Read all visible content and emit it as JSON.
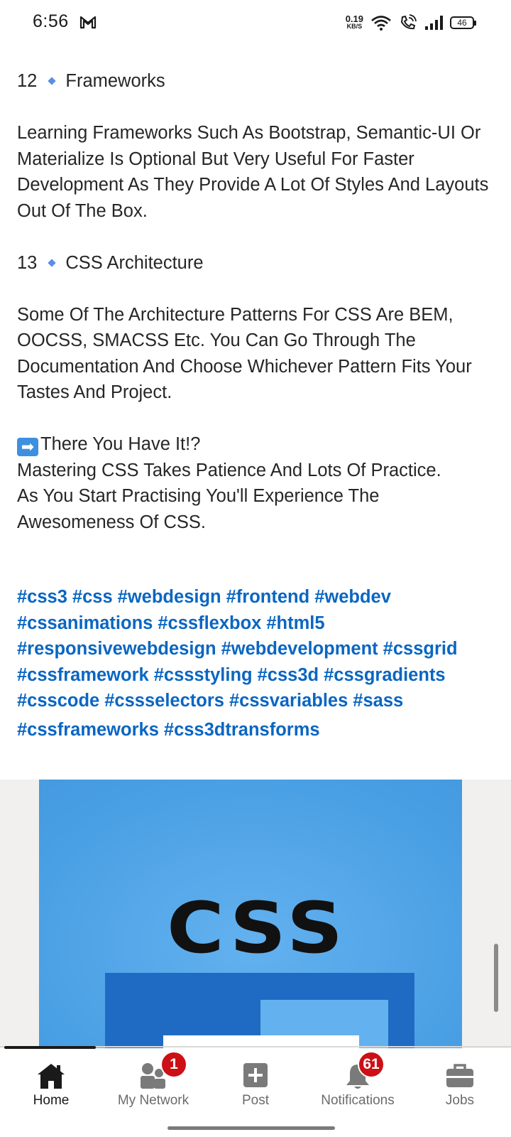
{
  "status_bar": {
    "time": "6:56",
    "net_speed_value": "0.19",
    "net_speed_unit": "KB/S",
    "battery": "46"
  },
  "article": {
    "section12_number": "12",
    "section12_title": "Frameworks",
    "section12_body": "Learning Frameworks Such As Bootstrap, Semantic-UI Or Materialize Is Optional But Very Useful For Faster Development As They Provide A Lot Of Styles And Layouts Out Of The Box.",
    "section13_number": "13",
    "section13_title": "CSS Architecture",
    "section13_body": "Some Of The Architecture Patterns For CSS Are BEM, OOCSS, SMACSS Etc. You Can Go Through The Documentation And Choose Whichever Pattern Fits Your Tastes And Project.",
    "closing_arrow": "➡",
    "closing_heading": "There You Have It!?",
    "closing_line1": "Mastering CSS Takes Patience And Lots Of Practice.",
    "closing_line2": "As You Start Practising You'll Experience The",
    "closing_line3": "Awesomeness Of CSS."
  },
  "hashtags": [
    "#css3",
    "#css",
    "#webdesign",
    "#frontend",
    "#webdev",
    "#cssanimations",
    "#cssflexbox",
    "#html5",
    "#responsivewebdesign",
    "#webdevelopment",
    "#cssgrid",
    "#cssframework",
    "#cssstyling",
    "#css3d",
    "#cssgradients",
    "#csscode",
    "#cssselectors",
    "#cssvariables",
    "#sass",
    "#cssframeworks",
    "#css3dtransforms"
  ],
  "post_image": {
    "logo_text": "CSS"
  },
  "bottom_nav": {
    "home": "Home",
    "my_network": "My Network",
    "my_network_badge": "1",
    "post": "Post",
    "notifications": "Notifications",
    "notifications_badge": "61",
    "jobs": "Jobs"
  },
  "colors": {
    "hashtag": "#0a66c2",
    "badge": "#cc1016",
    "image_bg": "#3f97e0"
  }
}
